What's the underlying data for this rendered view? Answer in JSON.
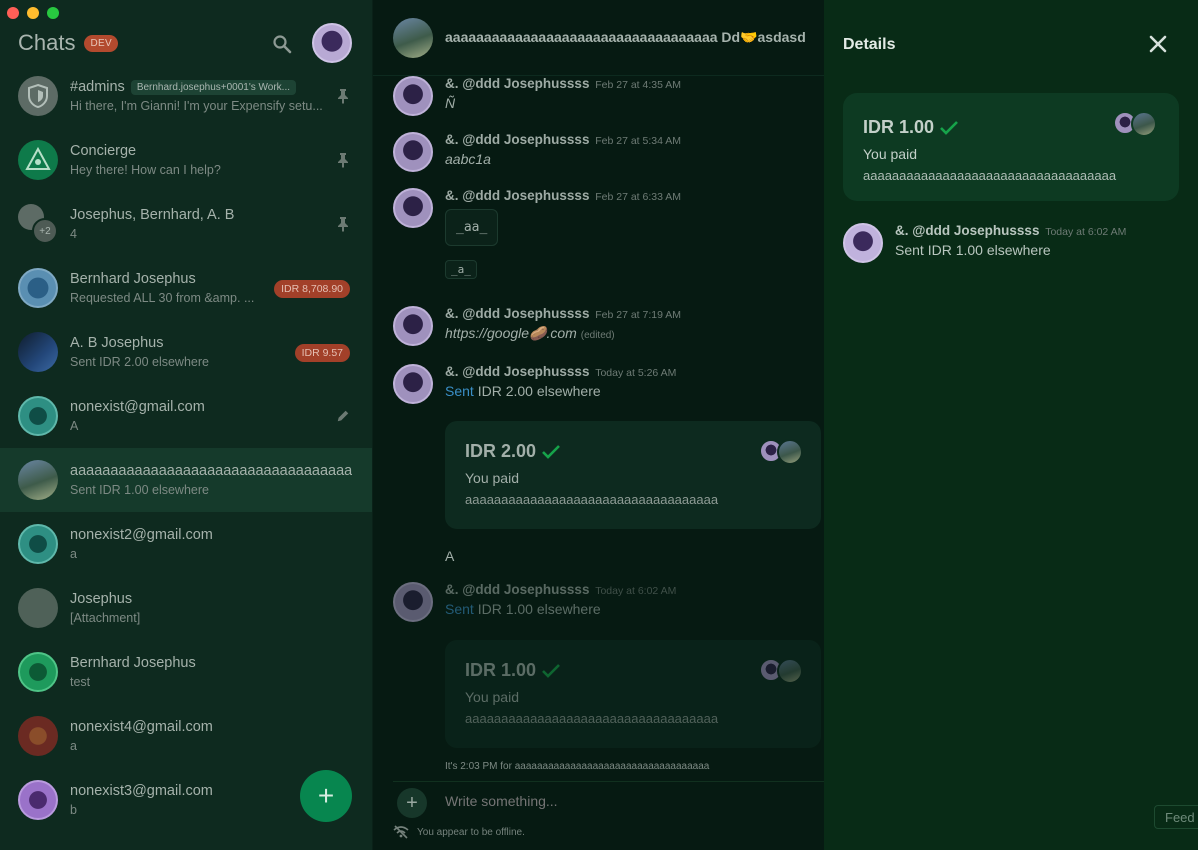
{
  "colors": {
    "accent": "#07864f",
    "danger_badge": "#a24029",
    "dev_badge": "#b34a2e",
    "link": "#3a8fc7",
    "check": "#16a34a"
  },
  "sidebar": {
    "title": "Chats",
    "env_badge": "DEV",
    "chats": [
      {
        "name": "#admins",
        "workspace": "Bernhard.josephus+0001's Work...",
        "preview": "Hi there, I'm Gianni! I'm your Expensify setu...",
        "icon": "pin-icon"
      },
      {
        "name": "Concierge",
        "preview": "Hey there! How can I help?",
        "icon": "pin-icon"
      },
      {
        "name": "Josephus, Bernhard, A. B",
        "preview": "4",
        "extra_count": "+2",
        "icon": "pin-icon"
      },
      {
        "name": "Bernhard Josephus",
        "preview": "Requested ALL 30 from &amp. ...",
        "badge": "IDR 8,708.90"
      },
      {
        "name": "A. B Josephus",
        "preview": "Sent IDR 2.00 elsewhere",
        "badge": "IDR 9.57"
      },
      {
        "name": "nonexist@gmail.com",
        "preview": "A",
        "icon": "pencil-icon"
      },
      {
        "name": "aaaaaaaaaaaaaaaaaaaaaaaaaaaaaaaaaaa...",
        "preview": "Sent IDR 1.00 elsewhere",
        "active": true
      },
      {
        "name": "nonexist2@gmail.com",
        "preview": "a"
      },
      {
        "name": "Josephus",
        "preview": "[Attachment]"
      },
      {
        "name": "Bernhard Josephus",
        "preview": "test"
      },
      {
        "name": "nonexist4@gmail.com",
        "preview": "a"
      },
      {
        "name": "nonexist3@gmail.com",
        "preview": "b"
      }
    ],
    "fab_label": "+"
  },
  "chat": {
    "header_title": "aaaaaaaaaaaaaaaaaaaaaaaaaaaaaaaaaaa Dd🤝asdasd",
    "messages": [
      {
        "author": "&. @ddd Josephussss",
        "time": "Feb 27 at 4:35 AM",
        "text": "Ñ"
      },
      {
        "author": "&. @ddd Josephussss",
        "time": "Feb 27 at 5:34 AM",
        "text": "aabc1a"
      },
      {
        "author": "&. @ddd Josephussss",
        "time": "Feb 27 at 6:33 AM",
        "code_block": "_aa_",
        "code_inline": "_a_"
      },
      {
        "author": "&. @ddd Josephussss",
        "time": "Feb 27 at 7:19 AM",
        "text": "https://google🥔.com",
        "edited": "(edited)"
      },
      {
        "author": "&. @ddd Josephussss",
        "time": "Today at 5:26 AM",
        "sent_word": "Sent",
        "text": " IDR 2.00 elsewhere"
      },
      {
        "author": "&. @ddd Josephussss",
        "time": "Today at 6:02 AM",
        "sent_word": "Sent",
        "text": " IDR 1.00 elsewhere"
      }
    ],
    "card1": {
      "amount": "IDR 2.00",
      "status": "You paid",
      "description": "aaaaaaaaaaaaaaaaaaaaaaaaaaaaaaaaaaa"
    },
    "plain_text": "A",
    "card2": {
      "amount": "IDR 1.00",
      "status": "You paid",
      "description": "aaaaaaaaaaaaaaaaaaaaaaaaaaaaaaaaaaa"
    },
    "system_line": "It's 2:03 PM for aaaaaaaaaaaaaaaaaaaaaaaaaaaaaaaaaaa",
    "composer_placeholder": "Write something...",
    "offline_text": "You appear to be offline."
  },
  "details": {
    "title": "Details",
    "card": {
      "amount": "IDR 1.00",
      "status": "You paid",
      "description": "aaaaaaaaaaaaaaaaaaaaaaaaaaaaaaaaaaa"
    },
    "message": {
      "author": "&. @ddd Josephussss",
      "time": "Today at 6:02 AM",
      "text": "Sent IDR 1.00 elsewhere"
    },
    "feedback_label": "Feed"
  }
}
